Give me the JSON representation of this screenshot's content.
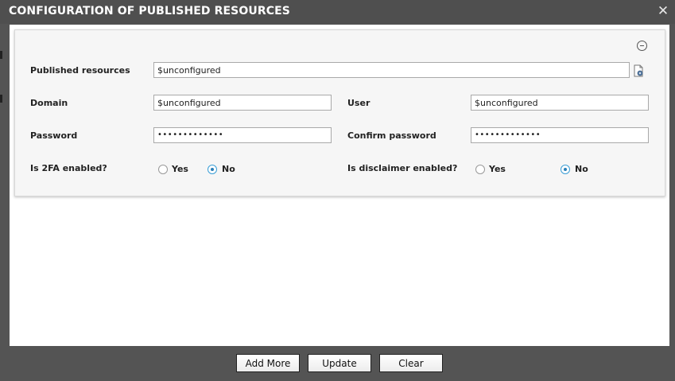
{
  "dialog": {
    "title": "CONFIGURATION OF PUBLISHED RESOURCES",
    "close_glyph": "✕"
  },
  "form": {
    "published_resources": {
      "label": "Published resources",
      "value": "$unconfigured"
    },
    "domain": {
      "label": "Domain",
      "value": "$unconfigured"
    },
    "user": {
      "label": "User",
      "value": "$unconfigured"
    },
    "password": {
      "label": "Password",
      "value": "•••••••••••••"
    },
    "confirm_password": {
      "label": "Confirm password",
      "value": "•••••••••••••"
    },
    "two_fa": {
      "label": "Is 2FA enabled?",
      "yes_label": "Yes",
      "no_label": "No",
      "selected": "No"
    },
    "disclaimer": {
      "label": "Is disclaimer enabled?",
      "yes_label": "Yes",
      "no_label": "No",
      "selected": "No"
    }
  },
  "footer": {
    "add_more": "Add More",
    "update": "Update",
    "clear": "Clear"
  },
  "icons": {
    "collapse": "minus-circle-icon",
    "browse": "document-gear-icon",
    "close": "close-icon"
  },
  "colors": {
    "frame": "#545454",
    "radio_accent": "#2a7fb8"
  }
}
